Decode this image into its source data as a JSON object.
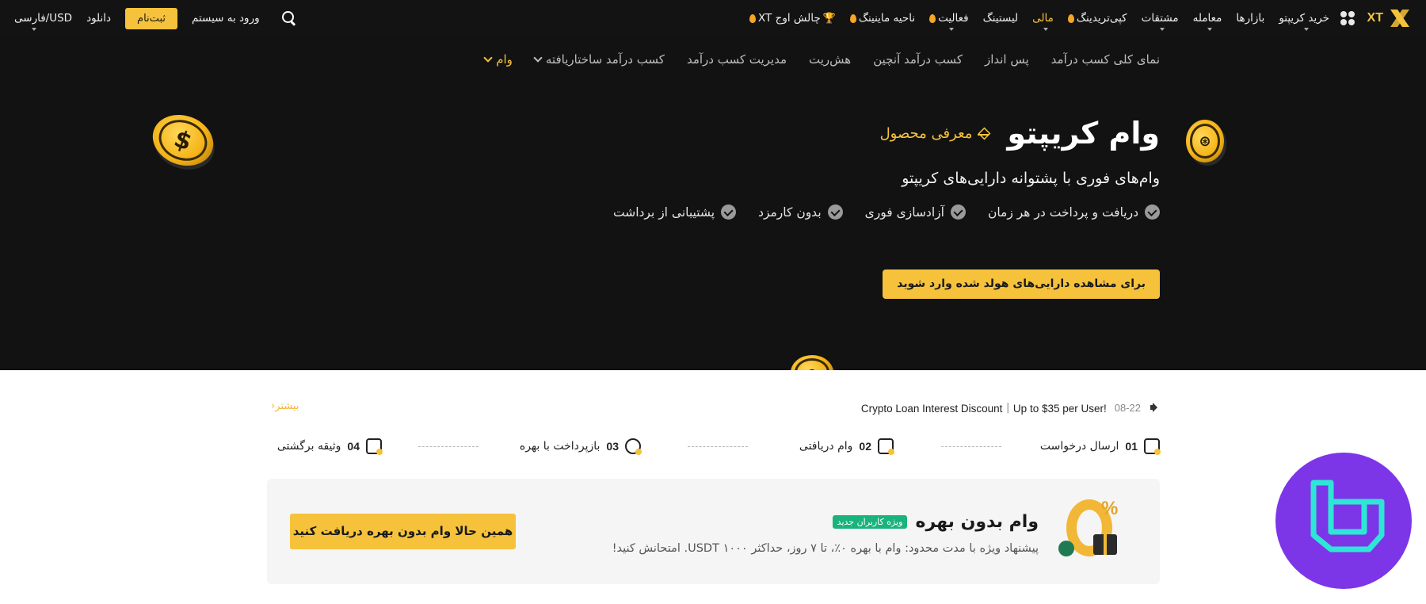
{
  "topnav": {
    "logo_text": "XT",
    "items": [
      {
        "label": "خرید کریپتو",
        "dropdown": true
      },
      {
        "label": "بازارها"
      },
      {
        "label": "معامله",
        "dropdown": true
      },
      {
        "label": "مشتقات",
        "dropdown": true
      },
      {
        "label": "کپی‌تریدینگ",
        "flame": true
      },
      {
        "label": "مالی",
        "active": true,
        "dropdown": true
      },
      {
        "label": "لیستینگ"
      },
      {
        "label": "فعالیت",
        "flame": true,
        "dropdown": true
      },
      {
        "label": "ناحیه ماینینگ",
        "flame": true
      },
      {
        "label": "چالش اوج XT",
        "trophy": true,
        "flame": true
      }
    ],
    "search_label": "",
    "login_label": "ورود به سیستم",
    "signup_label": "ثبت‌نام",
    "download_label": "دانلود",
    "language_label": "فارسی/USD"
  },
  "subnav": {
    "items": [
      "نمای کلی کسب درآمد",
      "پس انداز",
      "کسب درآمد آنچین",
      "هش‌ریت",
      "مدیریت کسب درآمد",
      "کسب درآمد ساختاریافته",
      "وام"
    ]
  },
  "hero": {
    "title": "وام کریپتو",
    "intro_link": "معرفی محصول",
    "subtitle": "وام‌های فوری با پشتوانه دارایی‌های کریپتو",
    "features": [
      "دریافت و پرداخت در هر زمان",
      "آزادسازی فوری",
      "بدون کارمزد",
      "پشتیبانی از برداشت"
    ],
    "cta_label": "برای مشاهده دارایی‌های هولد شده وارد شوید"
  },
  "notice": {
    "date": "08-22",
    "text": "Crypto Loan Interest Discount｜Up to $35 per User!",
    "more_label": "بیشتر"
  },
  "steps": [
    {
      "num": "01",
      "label": "ارسال درخواست"
    },
    {
      "num": "02",
      "label": "وام دریافتی"
    },
    {
      "num": "03",
      "label": "بازپرداخت با بهره"
    },
    {
      "num": "04",
      "label": "وثیقه برگشتی"
    }
  ],
  "promo": {
    "title": "وام بدون بهره",
    "badge": "ویژه کاربران جدید",
    "description": "پیشنهاد ویژه با مدت محدود: وام با بهره ۰٪، تا ۷ روز، حداکثر ۱۰۰۰ USDT. امتحانش کنید!",
    "button_label": "همین حالا وام بدون بهره دریافت کنید",
    "percent_symbol": "%"
  },
  "colors": {
    "accent": "#f6c23c",
    "hero_bg": "#121212",
    "badge": "#19b37d"
  }
}
